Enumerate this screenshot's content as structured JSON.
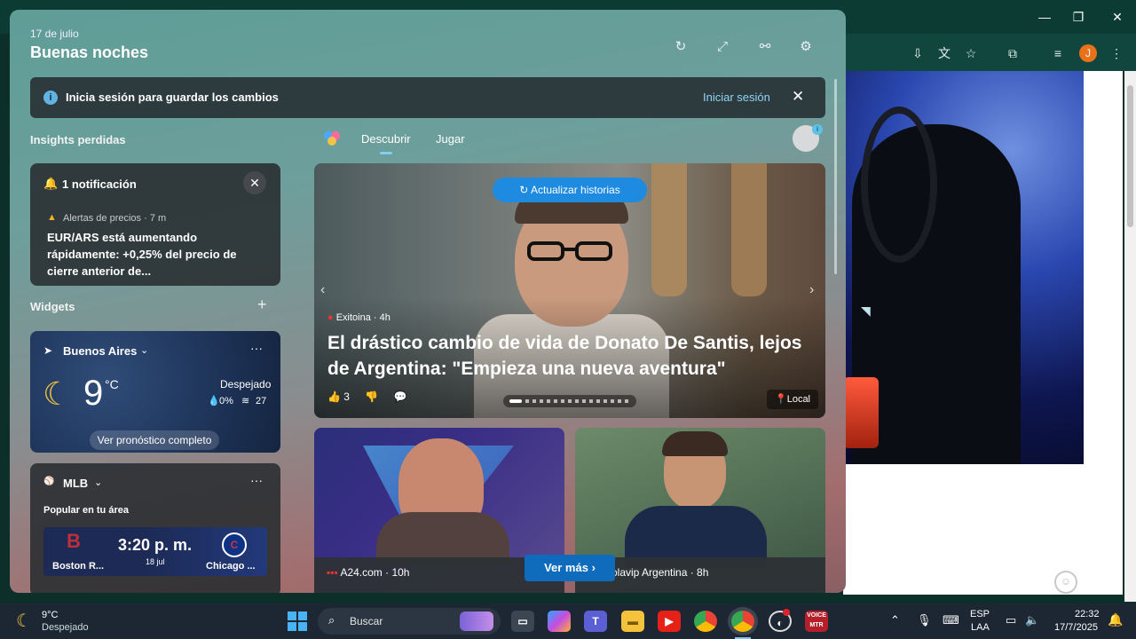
{
  "panel": {
    "date": "17 de julio",
    "greeting": "Buenas noches",
    "header_icons": [
      "refresh-icon",
      "expand-icon",
      "link-icon",
      "settings-icon"
    ]
  },
  "signin_bar": {
    "text": "Inicia sesión para guardar los cambios",
    "link": "Iniciar sesión"
  },
  "insights": {
    "title": "Insights perdidas",
    "notification_title": "1 notificación",
    "alert_source": "Alertas de precios · 7 m",
    "alert_text": "EUR/ARS está aumentando rápidamente: +0,25% del precio de cierre anterior de..."
  },
  "widgets": {
    "title": "Widgets",
    "add": "+",
    "weather": {
      "city": "Buenos Aires",
      "temp": "9",
      "unit": "°C",
      "condition": "Despejado",
      "precip": "0%",
      "wind": "27",
      "forecast_button": "Ver pronóstico completo"
    },
    "mlb": {
      "title": "MLB",
      "subtitle": "Popular en tu área",
      "time": "3:20 p. m.",
      "date": "18 jul",
      "home": "Boston R...",
      "away": "Chicago ..."
    }
  },
  "feed": {
    "tabs": [
      "Descubrir",
      "Jugar"
    ],
    "refresh_button": "Actualizar historias",
    "hero": {
      "source": "Exitoina · 4h",
      "title": "El drástico cambio de vida de Donato De Santis, lejos de Argentina: \"Empieza una nueva aventura\"",
      "likes": "3",
      "location": "Local"
    },
    "card1_source": "A24.com · 10h",
    "card2_source": "olavip Argentina · 8h",
    "more_button": "Ver más"
  },
  "taskbar": {
    "weather_temp": "9°C",
    "weather_condition": "Despejado",
    "search_placeholder": "Buscar",
    "lang": "ESP",
    "layout": "LAA",
    "time": "22:32",
    "date": "17/7/2025"
  },
  "browser": {
    "profile_letter": "J"
  }
}
